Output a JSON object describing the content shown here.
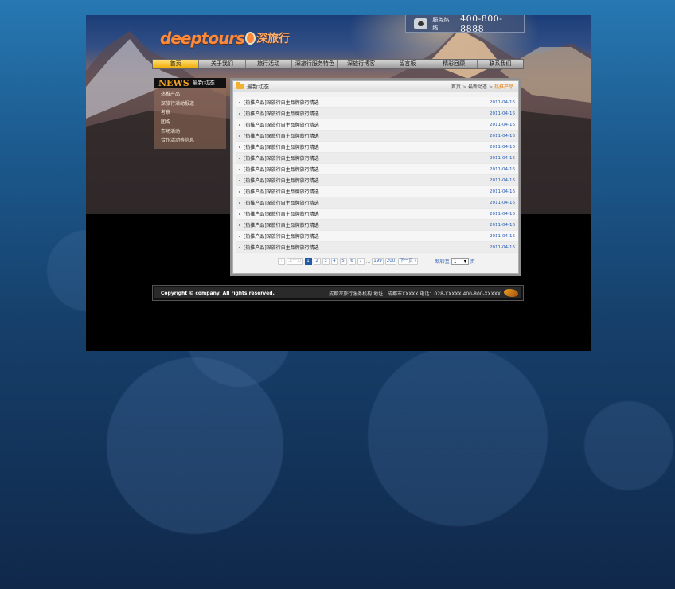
{
  "header": {
    "logo_en": "deeptours",
    "logo_cn": "深旅行",
    "hotline_label": "服务热线",
    "hotline_number": "400-800-8888"
  },
  "nav": {
    "items": [
      "首页",
      "关于我们",
      "旅行活动",
      "深旅行服务特色",
      "深旅行博客",
      "留言板",
      "精彩回顾",
      "联系我们"
    ],
    "active_index": 0
  },
  "sidebar": {
    "news_word": "NEWS",
    "title": "最新动态",
    "items": [
      "热推产品",
      "深旅行活动报道",
      "考察",
      "团购",
      "市场活动",
      "合作活动等信息"
    ]
  },
  "panel": {
    "title": "最新动态",
    "breadcrumb": [
      "首页",
      "最新动态",
      "热推产品"
    ]
  },
  "news": [
    {
      "title": "[热推产品]深旅行自主品牌旅行精选",
      "date": "2011-04-16"
    },
    {
      "title": "[热推产品]深旅行自主品牌旅行精选",
      "date": "2011-04-16"
    },
    {
      "title": "[热推产品]深旅行自主品牌旅行精选",
      "date": "2011-04-16"
    },
    {
      "title": "[热推产品]深旅行自主品牌旅行精选",
      "date": "2011-04-16"
    },
    {
      "title": "[热推产品]深旅行自主品牌旅行精选",
      "date": "2011-04-16"
    },
    {
      "title": "[热推产品]深旅行自主品牌旅行精选",
      "date": "2011-04-16"
    },
    {
      "title": "[热推产品]深旅行自主品牌旅行精选",
      "date": "2011-04-16"
    },
    {
      "title": "[热推产品]深旅行自主品牌旅行精选",
      "date": "2011-04-16"
    },
    {
      "title": "[热推产品]深旅行自主品牌旅行精选",
      "date": "2011-04-16"
    },
    {
      "title": "[热推产品]深旅行自主品牌旅行精选",
      "date": "2011-04-16"
    },
    {
      "title": "[热推产品]深旅行自主品牌旅行精选",
      "date": "2011-04-16"
    },
    {
      "title": "[热推产品]深旅行自主品牌旅行精选",
      "date": "2011-04-16"
    },
    {
      "title": "[热推产品]深旅行自主品牌旅行精选",
      "date": "2011-04-16"
    },
    {
      "title": "[热推产品]深旅行自主品牌旅行精选",
      "date": "2011-04-16"
    }
  ],
  "pagination": {
    "prev": "‹",
    "prev_label": "上一页",
    "pages": [
      "1",
      "2",
      "3",
      "4",
      "5",
      "6",
      "7"
    ],
    "current": "1",
    "ellipsis": "...",
    "tail_pages": [
      "199",
      "200"
    ],
    "next_label": "下一页 ›",
    "jump_label": "跳转至",
    "jump_value": "1",
    "jump_suffix": "页"
  },
  "footer": {
    "copyright": "Copyright © company. All rights reserved.",
    "info": "成都深旅行服务机构  地址：成都市XXXXX  电话：028-XXXXX  400-800-XXXXX"
  },
  "colors": {
    "accent": "#f0a020",
    "link": "#2a5db0",
    "nav_active": "#f0a900"
  }
}
